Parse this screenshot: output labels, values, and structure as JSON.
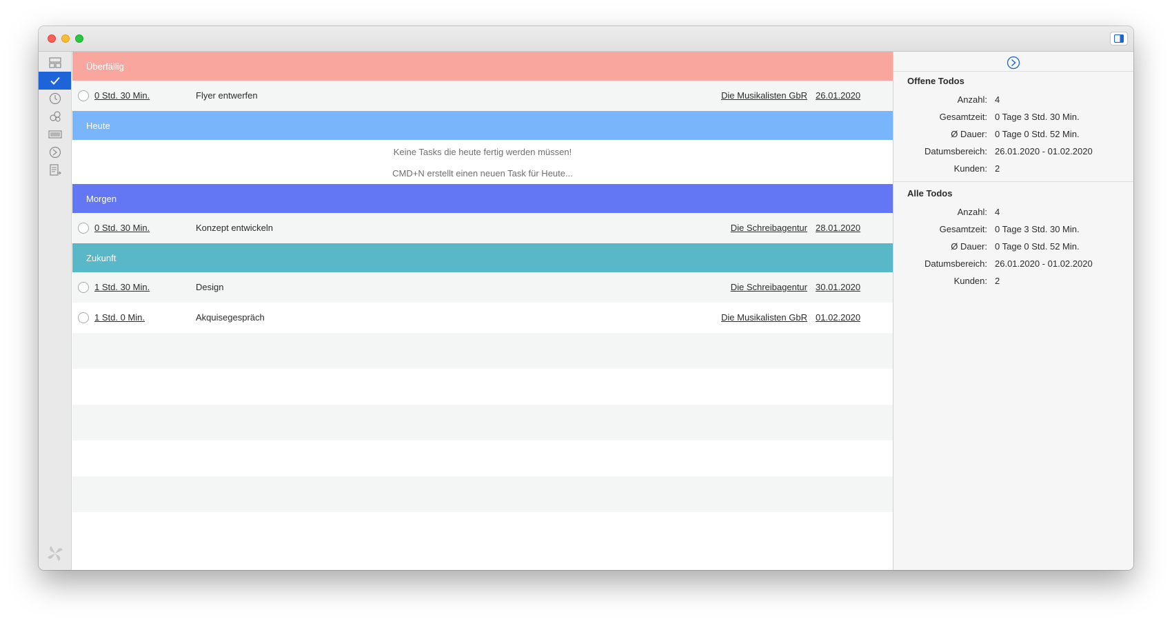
{
  "sections": {
    "overdue": {
      "label": "Überfällig",
      "color": "#f9a69e"
    },
    "today": {
      "label": "Heute",
      "color": "#78b5fb"
    },
    "tomorrow": {
      "label": "Morgen",
      "color": "#6377f5"
    },
    "future": {
      "label": "Zukunft",
      "color": "#58b8c8"
    }
  },
  "tasks": [
    {
      "duration": "0 Std. 30 Min.",
      "title": "Flyer entwerfen",
      "customer": "Die Musikalisten GbR",
      "date": "26.01.2020"
    },
    {
      "duration": "0 Std. 30 Min.",
      "title": "Konzept entwickeln",
      "customer": "Die Schreibagentur",
      "date": "28.01.2020"
    },
    {
      "duration": "1 Std. 30 Min.",
      "title": "Design",
      "customer": "Die Schreibagentur",
      "date": "30.01.2020"
    },
    {
      "duration": "1 Std. 0 Min.",
      "title": "Akquisegespräch",
      "customer": "Die Musikalisten GbR",
      "date": "01.02.2020"
    }
  ],
  "today_empty": {
    "message": "Keine Tasks die heute fertig werden müssen!",
    "hint": "CMD+N erstellt einen neuen Task für Heute..."
  },
  "toolbar": {
    "add": "+",
    "remove": "–"
  },
  "inspector": {
    "open": {
      "heading": "Offene Todos",
      "stats": [
        {
          "label": "Anzahl:",
          "value": "4"
        },
        {
          "label": "Gesamtzeit:",
          "value": "0 Tage 3 Std. 30 Min."
        },
        {
          "label": "Ø Dauer:",
          "value": "0 Tage 0 Std. 52 Min."
        },
        {
          "label": "Datumsbereich:",
          "value": "26.01.2020 - 01.02.2020"
        },
        {
          "label": "Kunden:",
          "value": "2"
        }
      ]
    },
    "all": {
      "heading": "Alle Todos",
      "stats": [
        {
          "label": "Anzahl:",
          "value": "4"
        },
        {
          "label": "Gesamtzeit:",
          "value": "0 Tage 3 Std. 30 Min."
        },
        {
          "label": "Ø Dauer:",
          "value": "0 Tage 0 Std. 52 Min."
        },
        {
          "label": "Datumsbereich:",
          "value": "26.01.2020 - 01.02.2020"
        },
        {
          "label": "Kunden:",
          "value": "2"
        }
      ]
    }
  },
  "sidebar_icons": [
    "dashboard-icon",
    "todos-checkmark-icon",
    "clock-icon",
    "customers-icon",
    "invoice-icon",
    "expenses-icon",
    "reports-icon"
  ],
  "colors": {
    "accent": "#1d64d8",
    "row_alt": "#f4f5f5"
  }
}
